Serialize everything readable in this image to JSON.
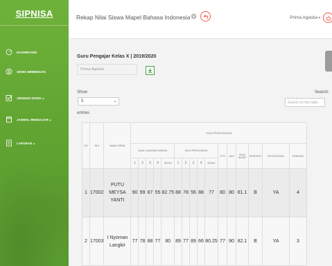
{
  "brand": {
    "name": "SIPNISA"
  },
  "sidebar": {
    "items": [
      {
        "label": "DASHBOARD",
        "icon": "dashboard-icon"
      },
      {
        "label": "SISWA BIMBINGAN",
        "icon": "student-icon"
      },
      {
        "label": "ABSENSI SISWA",
        "icon": "checkbox-icon",
        "has_caret": true
      },
      {
        "label": "JADWAL MENGAJAR",
        "icon": "calendar-icon",
        "has_caret": true
      },
      {
        "label": "LAPORAN",
        "icon": "report-icon",
        "has_caret": true
      }
    ],
    "caret": "▸"
  },
  "header": {
    "title": "Rekap Nilai Siswa Mapel Bahasa Indonesia",
    "user_name": "Prima Agastia",
    "user_caret": "▾"
  },
  "main": {
    "subtitle": "Guru Pengajar Kelas X | 2019/2020",
    "teacher_select": "Prima Agastia",
    "show_label": "Show",
    "entries_value": "5",
    "entries_caret": "♦",
    "entries_label": "entries",
    "search_label": "Search:",
    "search_placeholder": "Search on this table"
  },
  "table": {
    "headers": {
      "no": "NO",
      "nis": "NIS",
      "nama": "NAMA SISWA",
      "group": "NILAI PENGETAHUAN",
      "ulangan": "NILAI ULANGAN HARIAN",
      "penugasan": "NILAI PENUGASAN",
      "uts": "UTS",
      "uas": "UAS",
      "nilai_akhir": "NILAI AKHIR",
      "predikat": "PREDIKAT",
      "ketuntasan": "KETUNTASAN",
      "ranking": "RANKING",
      "sub_cols": [
        "1",
        "2",
        "3",
        "4",
        "RATA2",
        "1",
        "2",
        "3",
        "4",
        "RATA2"
      ]
    },
    "rows": [
      {
        "no": "1",
        "nis": "17002",
        "nama": "PUTU MEYSA YANTI",
        "uh": [
          "90",
          "99",
          "87",
          "55"
        ],
        "uh_rata": "82.75",
        "pn": [
          "88",
          "78",
          "56",
          "88"
        ],
        "pn_rata": "77",
        "uts": "80",
        "uas": "80",
        "akhir": "81.1",
        "predikat": "B",
        "ketuntasan": "YA",
        "ranking": "4"
      },
      {
        "no": "2",
        "nis": "17003",
        "nama": "I Nyoman Langkir",
        "uh": [
          "77",
          "78",
          "88",
          "77"
        ],
        "uh_rata": "80",
        "pn": [
          "89",
          "77",
          "89",
          "66"
        ],
        "pn_rata": "80.25",
        "uts": "77",
        "uas": "90",
        "akhir": "82.1",
        "predikat": "B",
        "ketuntasan": "YA",
        "ranking": "3"
      }
    ]
  },
  "colors": {
    "sidebar": "#62a532",
    "accent_red": "#f05a4f",
    "download_green": "#4a9d47"
  }
}
